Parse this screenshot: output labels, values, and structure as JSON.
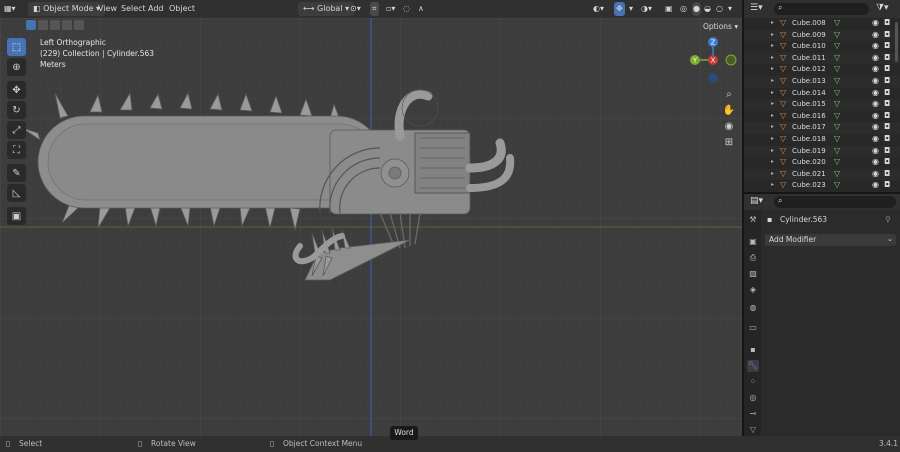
{
  "header": {
    "mode": "Object Mode",
    "menus": [
      "View",
      "Select",
      "Add",
      "Object"
    ],
    "transform_orientation": "Global",
    "options": "Options"
  },
  "viewport": {
    "view_name": "Left Orthographic",
    "collection_info": "(229) Collection | Cylinder.563",
    "units": "Meters",
    "gizmo": {
      "z": "Z",
      "y": "Y",
      "x": "X"
    }
  },
  "outliner": {
    "items": [
      "Cube.008",
      "Cube.009",
      "Cube.010",
      "Cube.011",
      "Cube.012",
      "Cube.013",
      "Cube.014",
      "Cube.015",
      "Cube.016",
      "Cube.017",
      "Cube.018",
      "Cube.019",
      "Cube.020",
      "Cube.021",
      "Cube.023"
    ]
  },
  "properties": {
    "object_name": "Cylinder.563",
    "add_modifier": "Add Modifier"
  },
  "status": {
    "select": "Select",
    "rotate": "Rotate View",
    "context": "Object Context Menu",
    "version": "3.4.1"
  },
  "tooltip": "Word",
  "colors": {
    "accent": "#4772b3",
    "object_orange": "#ef8a3c",
    "mesh_green": "#6fd36b",
    "axis_x": "#c83838",
    "axis_y": "#7dab2d",
    "axis_z": "#3a7ed4"
  }
}
